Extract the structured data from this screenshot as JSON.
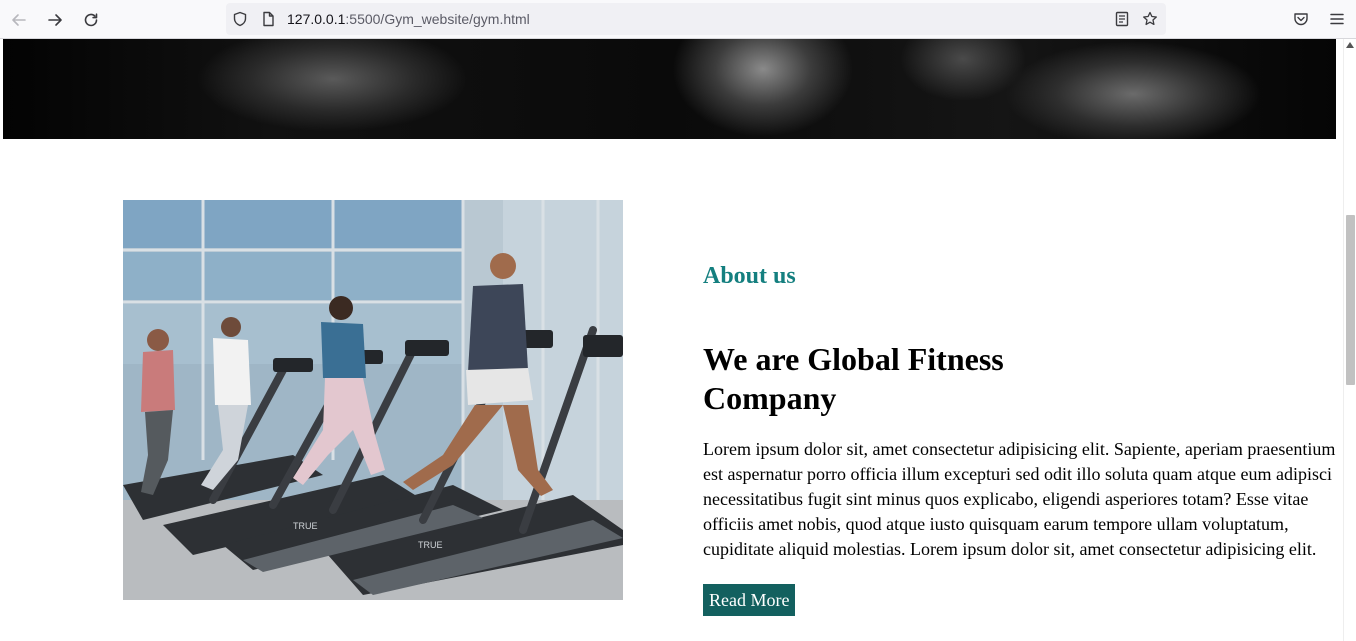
{
  "browser": {
    "url_host": "127.0.0.1",
    "url_path": ":5500/Gym_website/gym.html",
    "icons": {
      "back": "back-arrow-icon",
      "forward": "forward-arrow-icon",
      "reload": "reload-icon",
      "shield": "tracking-shield-icon",
      "page": "page-info-icon",
      "reader": "reader-view-icon",
      "bookmark": "bookmark-star-icon",
      "pocket": "pocket-icon",
      "menu": "hamburger-menu-icon"
    }
  },
  "about": {
    "subtitle": "About us",
    "title": "We are Global Fitness Company",
    "text": "Lorem ipsum dolor sit, amet consectetur adipisicing elit. Sapiente, aperiam praesentium est aspernatur porro officia illum excepturi sed odit illo soluta quam atque eum adipisci necessitatibus fugit sint minus quos explicabo, eligendi asperiores totam? Esse vitae officiis amet nobis, quod atque iusto quisquam earum tempore ullam voluptatum, cupiditate aliquid molestias. Lorem ipsum dolor sit, amet consectetur adipisicing elit.",
    "button_label": "Read More",
    "treadmill_brand": "TRUE"
  },
  "colors": {
    "accent": "#147f7f",
    "button_bg": "#13605f",
    "button_text": "#ffffff",
    "heading": "#000000"
  }
}
